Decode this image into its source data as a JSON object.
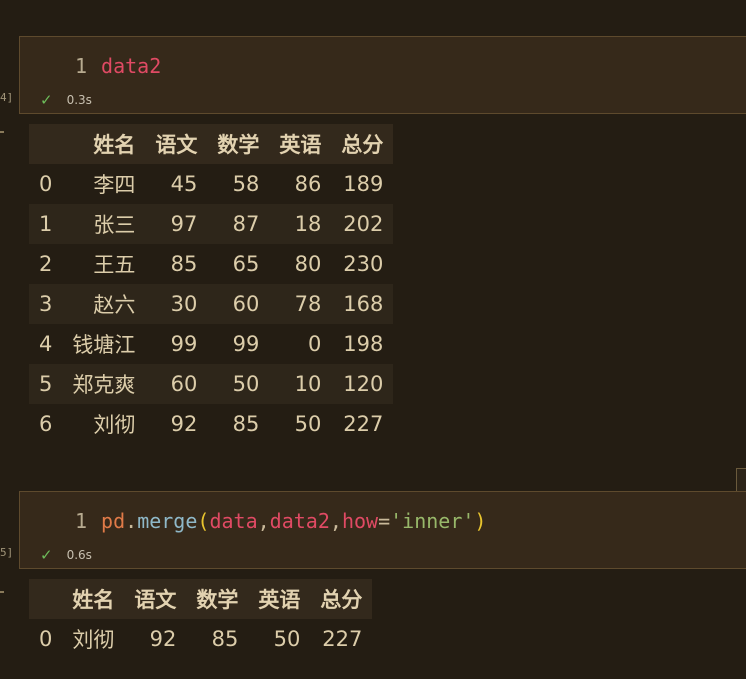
{
  "cells": [
    {
      "line_number": "1",
      "code_tokens": [
        {
          "text": "data2",
          "cls": "tk-var"
        }
      ],
      "duration": "0.3s",
      "exec_count": "4]",
      "output": {
        "columns": [
          "",
          "姓名",
          "语文",
          "数学",
          "英语",
          "总分"
        ],
        "rows": [
          [
            "0",
            "李四",
            "45",
            "58",
            "86",
            "189"
          ],
          [
            "1",
            "张三",
            "97",
            "87",
            "18",
            "202"
          ],
          [
            "2",
            "王五",
            "85",
            "65",
            "80",
            "230"
          ],
          [
            "3",
            "赵六",
            "30",
            "60",
            "78",
            "168"
          ],
          [
            "4",
            "钱塘江",
            "99",
            "99",
            "0",
            "198"
          ],
          [
            "5",
            "郑克爽",
            "60",
            "50",
            "10",
            "120"
          ],
          [
            "6",
            "刘彻",
            "92",
            "85",
            "50",
            "227"
          ]
        ]
      }
    },
    {
      "line_number": "1",
      "code_tokens": [
        {
          "text": "pd",
          "cls": "tk-mod"
        },
        {
          "text": ".",
          "cls": "tk-punct"
        },
        {
          "text": "merge",
          "cls": "tk-fn"
        },
        {
          "text": "(",
          "cls": "tk-p1"
        },
        {
          "text": "data",
          "cls": "tk-var"
        },
        {
          "text": ",",
          "cls": "tk-punct"
        },
        {
          "text": "data2",
          "cls": "tk-var"
        },
        {
          "text": ",",
          "cls": "tk-punct"
        },
        {
          "text": "how",
          "cls": "tk-kw"
        },
        {
          "text": "=",
          "cls": "tk-punct"
        },
        {
          "text": "'inner'",
          "cls": "tk-str"
        },
        {
          "text": ")",
          "cls": "tk-p1"
        }
      ],
      "duration": "0.6s",
      "exec_count": "5]",
      "output": {
        "columns": [
          "",
          "姓名",
          "语文",
          "数学",
          "英语",
          "总分"
        ],
        "rows": [
          [
            "0",
            "刘彻",
            "92",
            "85",
            "50",
            "227"
          ]
        ]
      }
    }
  ],
  "icons": {
    "status_check": "check-icon"
  },
  "colors": {
    "background": "#241d13",
    "cell_background": "#36291a",
    "success": "#6dbb5a"
  }
}
